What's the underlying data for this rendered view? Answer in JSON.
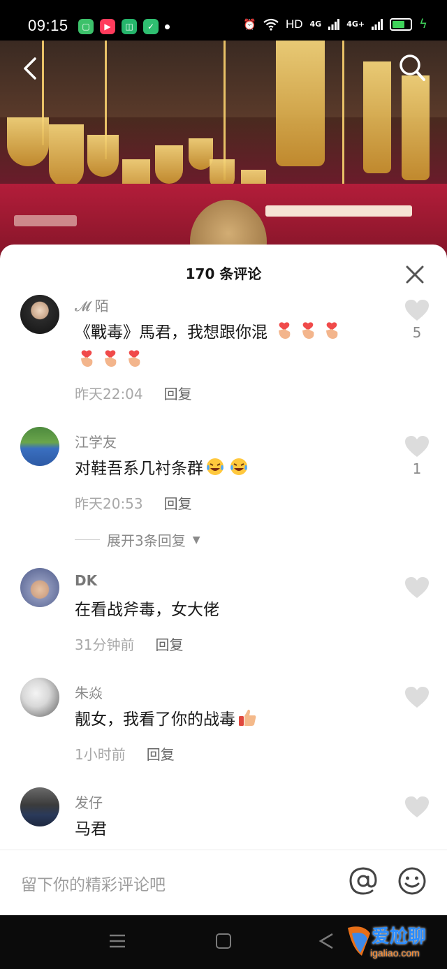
{
  "status": {
    "time": "09:15",
    "hd": "HD",
    "net1": "4G",
    "net2": "4G+"
  },
  "comments_header": {
    "title": "170 条评论"
  },
  "comments": [
    {
      "user": "𝓜 陌",
      "text_line1": "《戰毒》馬君，我想跟你混",
      "emoji": "finger-heart-emoji",
      "time": "昨天22:04",
      "reply": "回复",
      "likes": "5"
    },
    {
      "user": "江学友",
      "text": "对鞋吾系几衬条群",
      "emoji": "laughing-tears-emoji",
      "time": "昨天20:53",
      "reply": "回复",
      "likes": "1",
      "expand": "展开3条回复"
    },
    {
      "user": "DK",
      "text": "在看战斧毒，女大佬",
      "time": "31分钟前",
      "reply": "回复"
    },
    {
      "user": "朱焱",
      "text": "靓女，我看了你的战毒",
      "emoji": "thumbs-up-emoji",
      "time": "1小时前",
      "reply": "回复"
    },
    {
      "user": "发仔",
      "text": "马君"
    }
  ],
  "input": {
    "placeholder": "留下你的精彩评论吧"
  },
  "watermark": {
    "text": "爱尬聊",
    "url": "igaliao.com"
  },
  "colors": {
    "accent_green": "#3fd35a",
    "sheet_bg": "#ffffff",
    "meta_gray": "#a8a8a8"
  }
}
